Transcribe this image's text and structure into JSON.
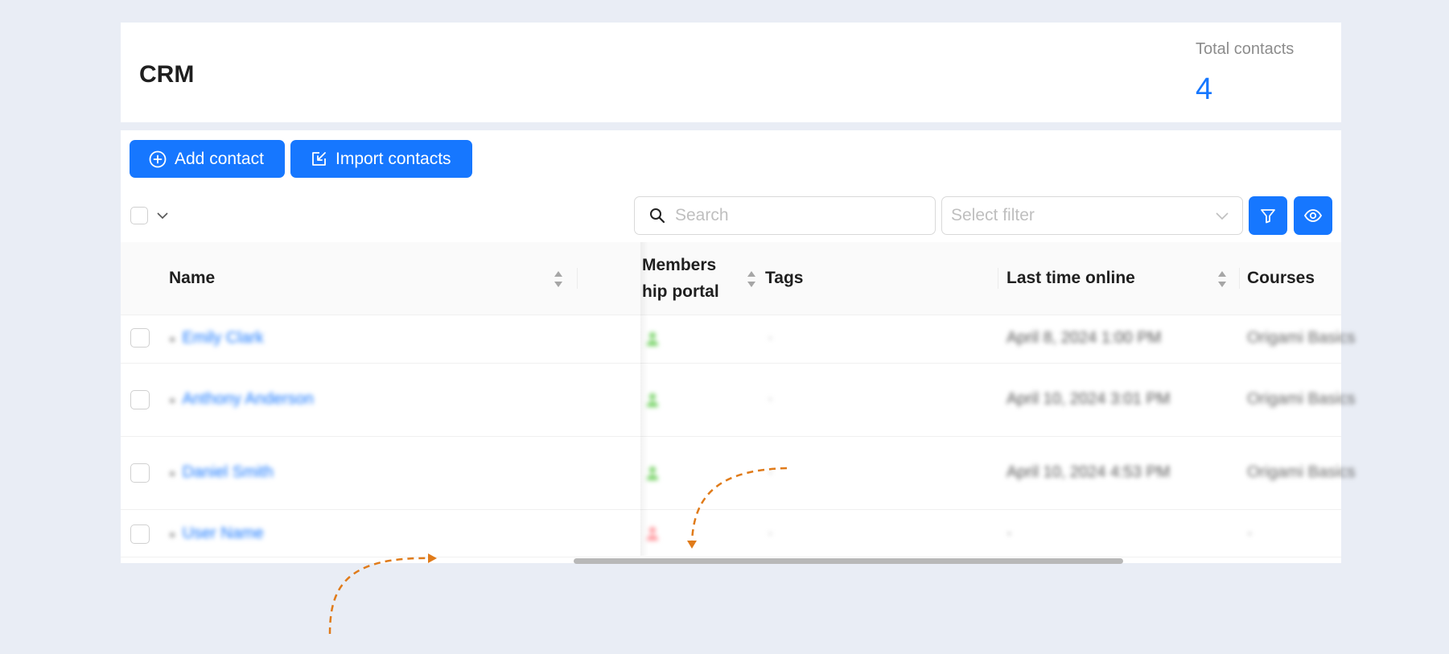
{
  "header": {
    "title": "CRM",
    "stat_label": "Total contacts",
    "stat_value": "4"
  },
  "toolbar": {
    "add_label": "Add contact",
    "import_label": "Import contacts",
    "search_placeholder": "Search",
    "filter_placeholder": "Select filter"
  },
  "table": {
    "columns": {
      "name": "Name",
      "membership_line1": "Members",
      "membership_line2": "hip portal",
      "tags": "Tags",
      "last_online": "Last time online",
      "courses": "Courses"
    },
    "rows": [
      {
        "name": "Emily Clark",
        "portal_status": "active",
        "tags": "·",
        "last_online": "April 8, 2024 1:00 PM",
        "course": "Origami Basics"
      },
      {
        "name": "Anthony Anderson",
        "portal_status": "active",
        "tags": "·",
        "last_online": "April 10, 2024 3:01 PM",
        "course": "Origami Basics"
      },
      {
        "name": "Daniel Smith",
        "portal_status": "active",
        "tags": "·",
        "last_online": "April 10, 2024 4:53 PM",
        "course": "Origami Basics"
      },
      {
        "name": "User Name",
        "portal_status": "inactive",
        "tags": "·",
        "last_online": "·",
        "course": "·"
      }
    ]
  },
  "colors": {
    "accent": "#1677ff",
    "portal_active": "#7ad36a",
    "portal_inactive": "#ff9aa0",
    "annotation": "#e07b1a"
  }
}
